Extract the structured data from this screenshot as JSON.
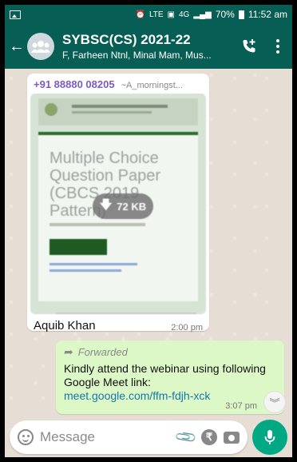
{
  "status_bar": {
    "network_label": "LTE",
    "signal_label": "4G",
    "battery": "70%",
    "time": "11:52 am"
  },
  "header": {
    "title": "SYBSC(CS) 2021-22",
    "subtitle": "F, Farheen Ntnl, Minal Mam, Mus..."
  },
  "messages": {
    "incoming": {
      "sender_phone": "+91 88880 08205",
      "sender_alias": "~A_morningst...",
      "document": {
        "title": "Multiple Choice Question Paper (CBCS 2019 Pattern)",
        "size": "72 KB"
      },
      "caption": "Aquib Khan",
      "time": "2:00 pm"
    },
    "outgoing": {
      "forwarded_label": "Forwarded",
      "text": "Kindly attend the webinar using following Google Meet link:",
      "link": "meet.google.com/ffm-fdjh-xck",
      "time": "3:07 pm"
    }
  },
  "input": {
    "placeholder": "Message",
    "rupee_symbol": "₹"
  },
  "colors": {
    "header_bg": "#075e54",
    "accent": "#00a884",
    "outgoing_bubble": "#dcf8c6",
    "link": "#1976a8"
  }
}
